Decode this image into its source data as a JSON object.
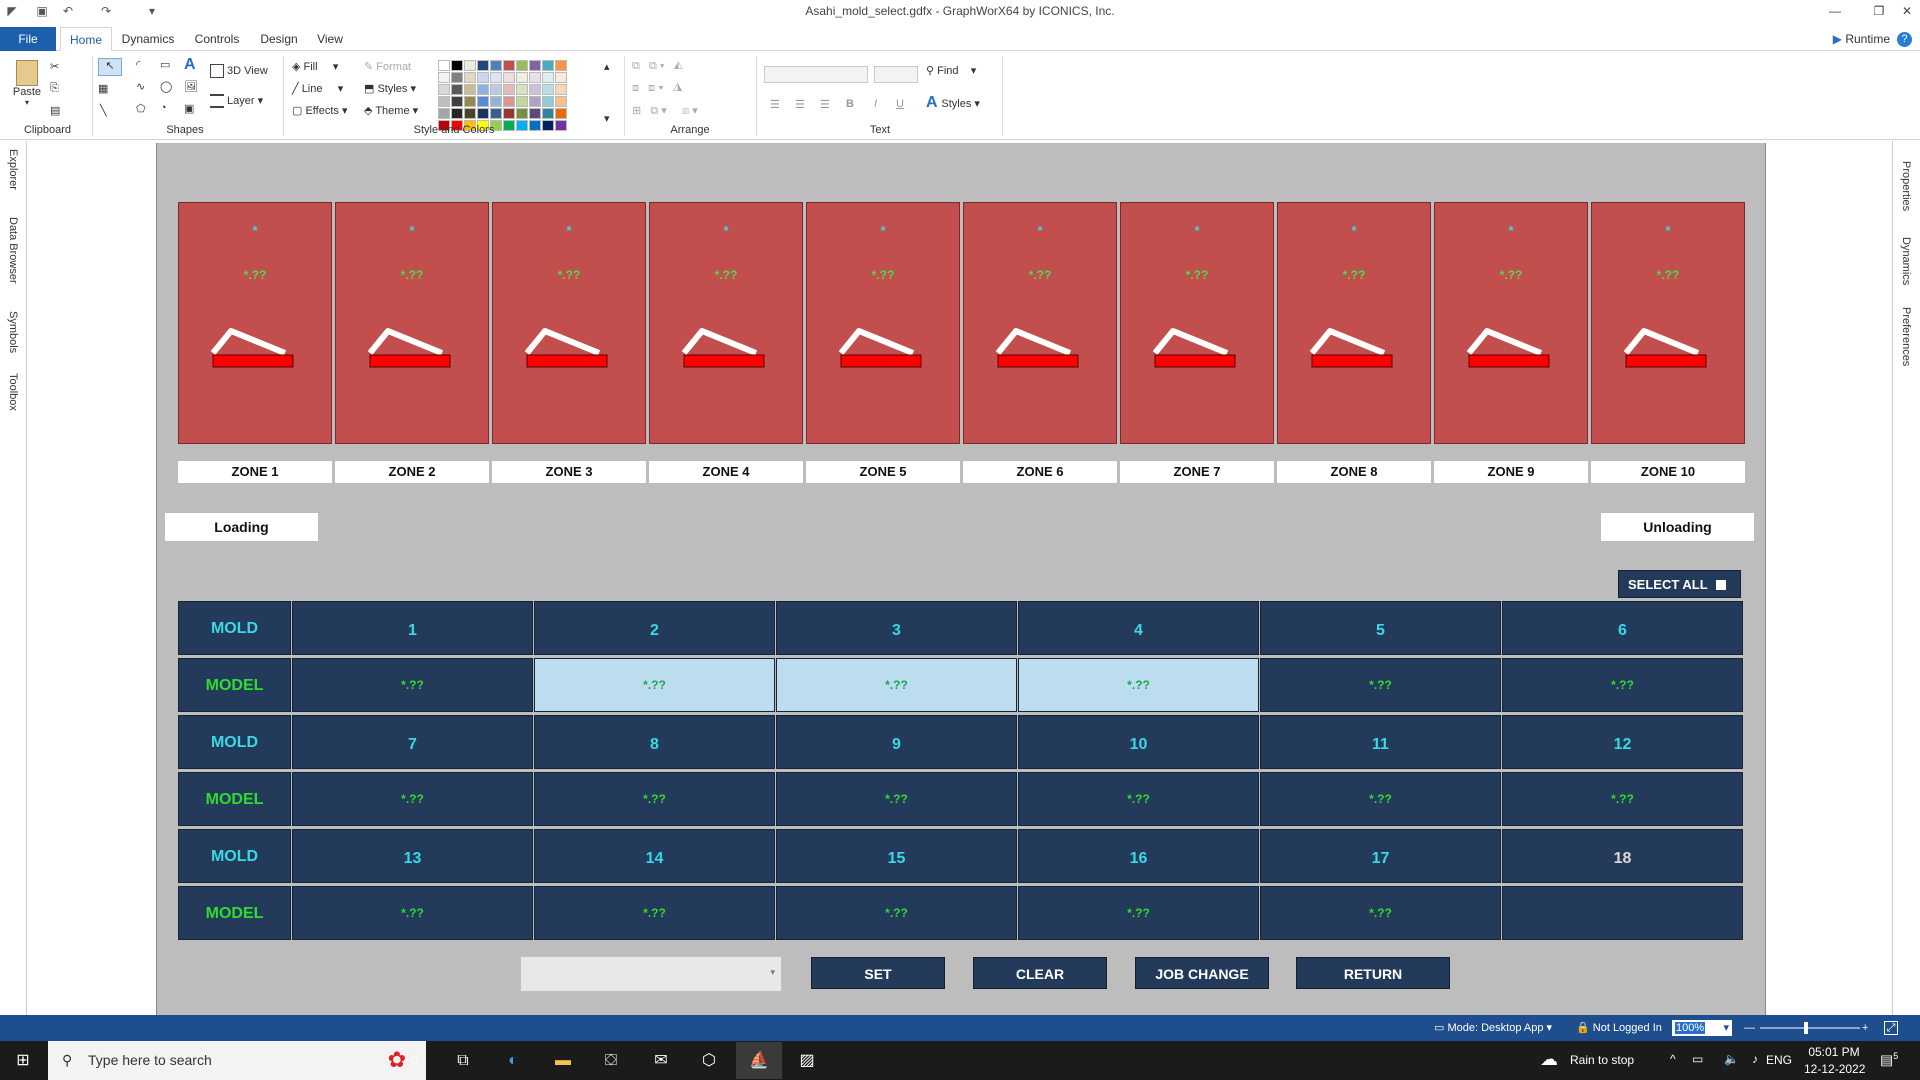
{
  "window": {
    "title": "Asahi_mold_select.gdfx - GraphWorX64 by ICONICS, Inc."
  },
  "tabs": [
    "File",
    "Home",
    "Dynamics",
    "Controls",
    "Design",
    "View"
  ],
  "runtime_label": "Runtime",
  "ribbon": {
    "clipboard": {
      "paste": "Paste",
      "label": "Clipboard"
    },
    "shapes": {
      "view3d": "3D View",
      "layer": "Layer",
      "label": "Shapes"
    },
    "style": {
      "fill": "Fill",
      "format": "Format",
      "line": "Line",
      "styles": "Styles",
      "effects": "Effects",
      "theme": "Theme",
      "label": "Style and Colors"
    },
    "arrange": {
      "label": "Arrange"
    },
    "text": {
      "find": "Find",
      "styles": "Styles",
      "label": "Text",
      "bold": "B",
      "italic": "I",
      "underline": "U"
    }
  },
  "left_panels": [
    "Explorer",
    "Data Browser",
    "Symbols",
    "Toolbox"
  ],
  "right_panels": [
    "Properties",
    "Dynamics",
    "Preferences"
  ],
  "zones": [
    {
      "name": "ZONE 1",
      "star": "*",
      "value": "*.??"
    },
    {
      "name": "ZONE 2",
      "star": "*",
      "value": "*.??"
    },
    {
      "name": "ZONE 3",
      "star": "*",
      "value": "*.??"
    },
    {
      "name": "ZONE 4",
      "star": "*",
      "value": "*.??"
    },
    {
      "name": "ZONE 5",
      "star": "*",
      "value": "*.??"
    },
    {
      "name": "ZONE 6",
      "star": "*",
      "value": "*.??"
    },
    {
      "name": "ZONE 7",
      "star": "*",
      "value": "*.??"
    },
    {
      "name": "ZONE 8",
      "star": "*",
      "value": "*.??"
    },
    {
      "name": "ZONE 9",
      "star": "*",
      "value": "*.??"
    },
    {
      "name": "ZONE 10",
      "star": "*",
      "value": "*.??"
    }
  ],
  "loading_label": "Loading",
  "unloading_label": "Unloading",
  "select_all_label": "SELECT ALL",
  "grid": {
    "mold_label": "MOLD",
    "model_label": "MODEL",
    "rows": [
      {
        "molds": [
          "1",
          "2",
          "3",
          "4",
          "5",
          "6"
        ],
        "models": [
          "*.??",
          "*.??",
          "*.??",
          "*.??",
          "*.??",
          "*.??"
        ],
        "selected": [
          false,
          true,
          true,
          true,
          false,
          false
        ]
      },
      {
        "molds": [
          "7",
          "8",
          "9",
          "10",
          "11",
          "12"
        ],
        "models": [
          "*.??",
          "*.??",
          "*.??",
          "*.??",
          "*.??",
          "*.??"
        ],
        "selected": [
          false,
          false,
          false,
          false,
          false,
          false
        ]
      },
      {
        "molds": [
          "13",
          "14",
          "15",
          "16",
          "17",
          "18"
        ],
        "models": [
          "*.??",
          "*.??",
          "*.??",
          "*.??",
          "*.??",
          ""
        ],
        "selected": [
          false,
          false,
          false,
          false,
          false,
          false
        ]
      }
    ]
  },
  "buttons": {
    "set": "SET",
    "clear": "CLEAR",
    "job_change": "JOB CHANGE",
    "return": "RETURN"
  },
  "status": {
    "mode": "Mode: Desktop App",
    "login": "Not Logged In",
    "zoom": "100%"
  },
  "taskbar": {
    "search_placeholder": "Type here to search",
    "weather": "Rain to stop",
    "lang": "ENG",
    "time": "05:01 PM",
    "date": "12-12-2022",
    "notifications": "5"
  }
}
